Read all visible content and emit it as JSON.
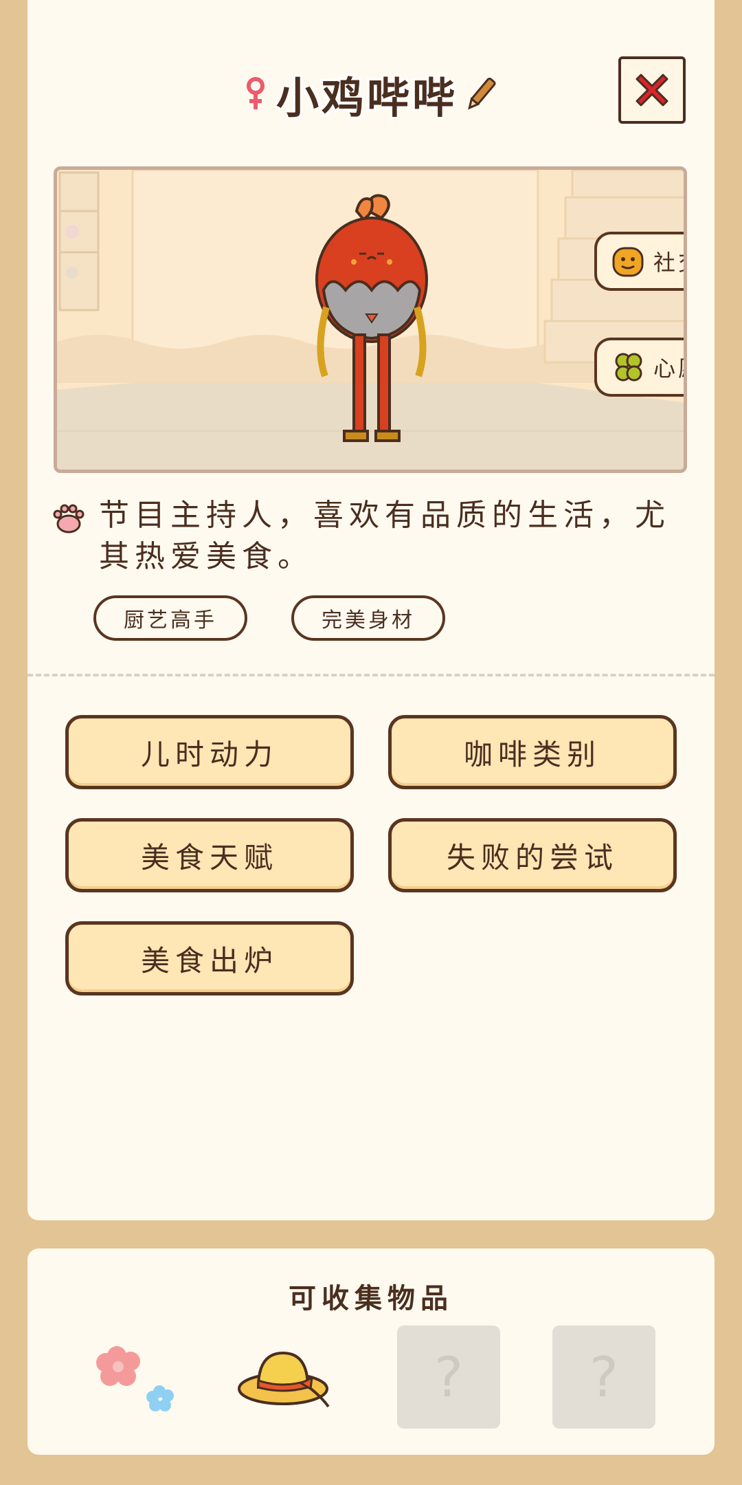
{
  "header": {
    "character_name": "小鸡哔哔",
    "gender_icon": "female-icon",
    "edit_icon": "pencil-icon",
    "close_icon": "close-icon"
  },
  "scene": {
    "social_label": "社交",
    "wish_label": "心愿"
  },
  "profile": {
    "description": "节目主持人，喜欢有品质的生活，尤其热爱美食。",
    "tags": [
      "厨艺高手",
      "完美身材"
    ]
  },
  "story_buttons": [
    "儿时动力",
    "咖啡类别",
    "美食天赋",
    "失败的尝试",
    "美食出炉"
  ],
  "collectibles": {
    "title": "可收集物品",
    "slots": [
      {
        "icon": "flowers-icon"
      },
      {
        "icon": "straw-hat-icon"
      },
      {
        "placeholder": "?"
      },
      {
        "placeholder": "?"
      }
    ]
  },
  "colors": {
    "background": "#e3c495",
    "card": "#fffaf0",
    "button_fill": "#ffe6b5",
    "outline": "#5a3520",
    "close_red": "#d7262a",
    "chicken_red": "#d8401f"
  }
}
